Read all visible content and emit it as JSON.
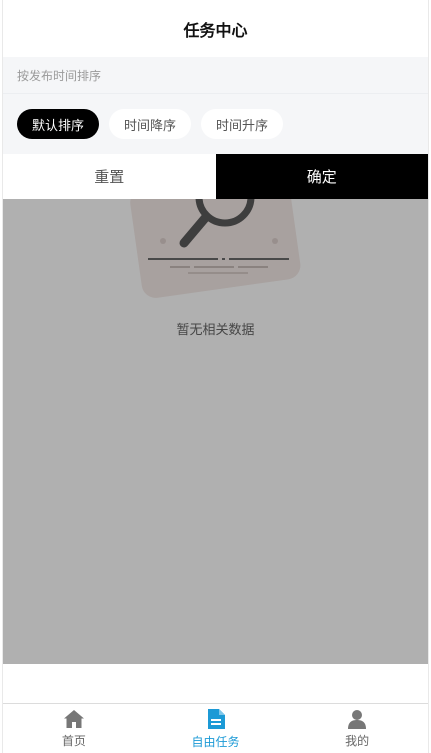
{
  "header": {
    "title": "任务中心"
  },
  "sort": {
    "label": "按发布时间排序",
    "options": [
      {
        "label": "默认排序",
        "selected": true
      },
      {
        "label": "时间降序",
        "selected": false
      },
      {
        "label": "时间升序",
        "selected": false
      }
    ]
  },
  "actions": {
    "reset_label": "重置",
    "confirm_label": "确定"
  },
  "content": {
    "empty_text": "暂无相关数据",
    "empty_icon": "magnifier-icon"
  },
  "tabbar": {
    "items": [
      {
        "label": "首页",
        "icon": "home-icon",
        "active": false
      },
      {
        "label": "自由任务",
        "icon": "document-icon",
        "active": true
      },
      {
        "label": "我的",
        "icon": "person-icon",
        "active": false
      }
    ],
    "active_color": "#1c9ad6",
    "inactive_color": "#666666"
  }
}
